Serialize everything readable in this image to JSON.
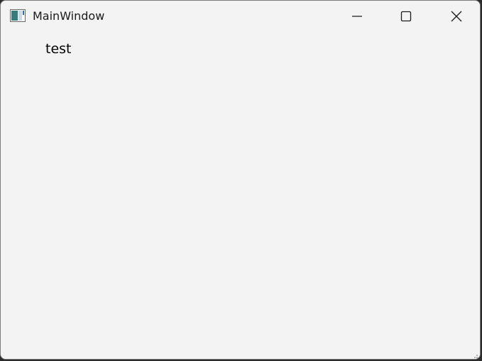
{
  "window": {
    "title": "MainWindow",
    "icon": "application-window-icon"
  },
  "caption_buttons": {
    "minimize_icon": "minimize-icon",
    "maximize_icon": "maximize-icon",
    "close_icon": "close-icon"
  },
  "content": {
    "label": "test"
  },
  "colors": {
    "window_bg": "#f3f3f3",
    "text": "#000000",
    "border": "#7a7a7a"
  }
}
